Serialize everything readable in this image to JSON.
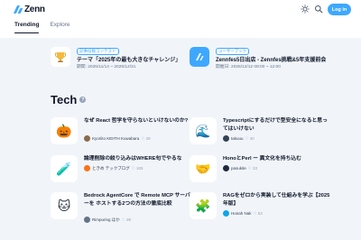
{
  "header": {
    "logo_text": "Zenn",
    "login_label": "Log in",
    "tabs": [
      {
        "label": "Trending"
      },
      {
        "label": "Explore"
      }
    ]
  },
  "events": [
    {
      "tag": "記事投稿コンテスト",
      "title": "テーマ「2025年の最も大きなチャレンジ」",
      "date": "期間: 2025/11/14 ~ 2025/12/31",
      "icon": "trophy-icon"
    },
    {
      "tag": "ユーザーブック",
      "title": "Zennfes5日出店 - Zennfes挑戦&5年支援前会",
      "date": "開催日: 2025/12/12 08:00 ~ 12:00",
      "icon": "zenn-logo-icon"
    }
  ],
  "section": {
    "title": "Tech",
    "help": "?"
  },
  "articles": [
    {
      "title": "なぜ React 哲学を守らないといけないのか?",
      "author": "Kyoriito KEIITH Kuwabara",
      "likes": "♡ 29",
      "emoji": "🎃",
      "col": 0,
      "row": 0
    },
    {
      "title": "Typescriptにするだけで型安全になると思ってはいけない",
      "author": "takuuu",
      "likes": "♡ 40",
      "emoji": "🌊",
      "col": 1,
      "row": 0
    },
    {
      "title": "論理削除の絞り込みはWHERE句でやるな",
      "author": "ときめ テックブログ",
      "likes": "♡ 105",
      "emoji": "🧪",
      "col": 0,
      "row": 1
    },
    {
      "title": "HonoとPerl ー 異文化を持ち込む",
      "author": "pasukite",
      "likes": "♡ 33",
      "emoji": "🤝",
      "col": 1,
      "row": 1
    },
    {
      "title": "Bedrock AgentCore で Remote MCP サーバーを ホストする2つの方法の徹底比較",
      "author": "Rimpuring ほか",
      "likes": "♡ 39",
      "emoji": "🐱",
      "col": 0,
      "row": 2
    },
    {
      "title": "RAGをゼロから実装して仕組みを学ぶ【2025年版】",
      "author": "Honah Nak",
      "likes": "♡ 53",
      "emoji": "🧩",
      "col": 1,
      "row": 2
    }
  ]
}
